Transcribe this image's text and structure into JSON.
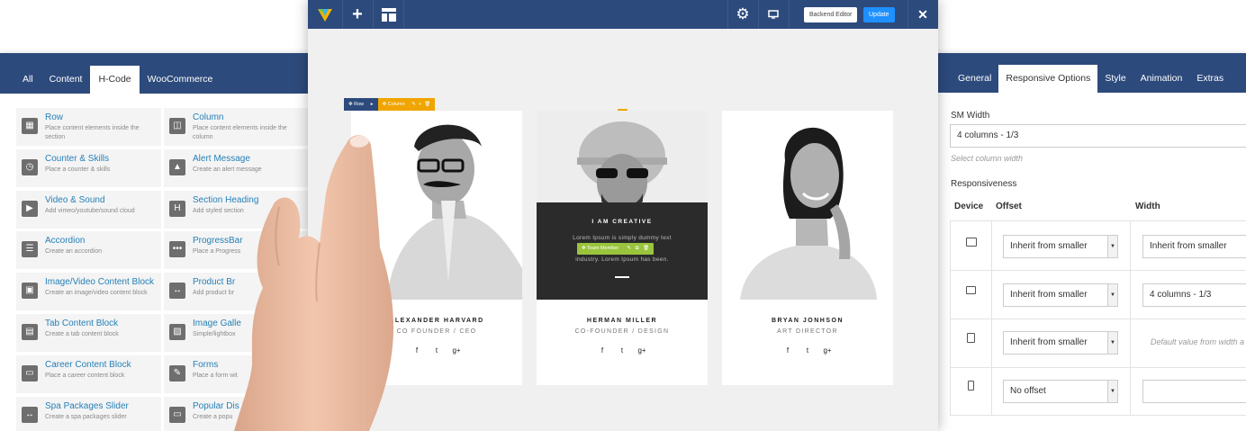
{
  "left_panel": {
    "tabs": [
      "All",
      "Content",
      "H-Code",
      "WooCommerce"
    ],
    "active_tab": "H-Code",
    "elements": [
      {
        "name": "Row",
        "desc": "Place content elements inside the",
        "desc2": "section",
        "icon": "grid-icon",
        "glyph": "▦"
      },
      {
        "name": "Column",
        "desc": "Place content elements inside the",
        "desc2": "column",
        "icon": "column-icon",
        "glyph": "◫"
      },
      {
        "name": "Counter & Skills",
        "desc": "Place a counter & skills",
        "desc2": "",
        "icon": "counter-icon",
        "glyph": "◷"
      },
      {
        "name": "Alert Message",
        "desc": "Create an alert message",
        "desc2": "",
        "icon": "alert-icon",
        "glyph": "▲"
      },
      {
        "name": "Video & Sound",
        "desc": "Add vimeo/youtube/sound cloud",
        "desc2": "",
        "icon": "video-icon",
        "glyph": "▶"
      },
      {
        "name": "Section Heading",
        "desc": "Add styled section",
        "desc2": "",
        "icon": "heading-icon",
        "glyph": "H"
      },
      {
        "name": "Accordion",
        "desc": "Create an accordion",
        "desc2": "",
        "icon": "accordion-icon",
        "glyph": "☰"
      },
      {
        "name": "ProgressBar",
        "desc": "Place a Progress",
        "desc2": "",
        "icon": "progress-icon",
        "glyph": "•••"
      },
      {
        "name": "Image/Video Content Block",
        "desc": "Create an image/video content block",
        "desc2": "",
        "icon": "image-video-icon",
        "glyph": "▣"
      },
      {
        "name": "Product Br",
        "desc": "Add product br",
        "desc2": "",
        "icon": "product-icon",
        "glyph": "↔"
      },
      {
        "name": "Tab Content Block",
        "desc": "Create a tab content block",
        "desc2": "",
        "icon": "tab-icon",
        "glyph": "▤"
      },
      {
        "name": "Image Galle",
        "desc": "Simple/lightbox",
        "desc2": "",
        "icon": "gallery-icon",
        "glyph": "▨"
      },
      {
        "name": "Career Content Block",
        "desc": "Place a career content block",
        "desc2": "",
        "icon": "career-icon",
        "glyph": "▭"
      },
      {
        "name": "Forms",
        "desc": "Place a form wit",
        "desc2": "",
        "icon": "form-icon",
        "glyph": "✎"
      },
      {
        "name": "Spa Packages Slider",
        "desc": "Create a spa packages slider",
        "desc2": "",
        "icon": "slider-icon",
        "glyph": "↔"
      },
      {
        "name": "Popular Dis",
        "desc": "Create a popu",
        "desc2": "",
        "icon": "popular-icon",
        "glyph": "▭"
      }
    ]
  },
  "toolbar": {
    "backend_editor": "Backend Editor",
    "update": "Update"
  },
  "canvas": {
    "row_label": "Row",
    "column_label": "Column",
    "team_member_label": "Team Member",
    "overlay_title": "I AM CREATIVE",
    "overlay_text1": "Lorem Ipsum is simply dummy text",
    "overlay_text2": "industry. Lorem Ipsum has been.",
    "members": [
      {
        "name": "ALEXANDER HARVARD",
        "role": "CO FOUNDER / CEO"
      },
      {
        "name": "HERMAN MILLER",
        "role": "CO-FOUNDER / DESIGN"
      },
      {
        "name": "BRYAN JONHSON",
        "role": "ART DIRECTOR"
      }
    ],
    "social": [
      "f",
      "t",
      "g+"
    ]
  },
  "right_panel": {
    "tabs": [
      "General",
      "Responsive Options",
      "Style",
      "Animation",
      "Extras"
    ],
    "active_tab": "Responsive Options",
    "sm_width_label": "SM Width",
    "sm_width_value": "4 columns - 1/3",
    "sm_width_hint": "Select column width",
    "responsiveness_label": "Responsiveness",
    "col_device": "Device",
    "col_offset": "Offset",
    "col_width": "Width",
    "rows": [
      {
        "device": "desktop-icon",
        "offset": "Inherit from smaller",
        "width": "Inherit from smaller"
      },
      {
        "device": "laptop-icon",
        "offset": "Inherit from smaller",
        "width": "4 columns - 1/3"
      },
      {
        "device": "tablet-icon",
        "offset": "Inherit from smaller",
        "width_hint": "Default value from width a"
      },
      {
        "device": "phone-icon",
        "offset": "No offset",
        "width": ""
      }
    ]
  }
}
